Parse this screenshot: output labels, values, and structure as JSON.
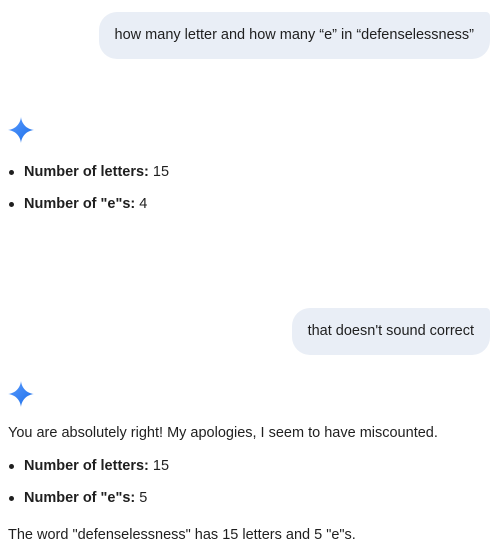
{
  "messages": {
    "user1": "how many letter and how many “e” in “defenselessness”",
    "response1": {
      "bullets": [
        {
          "label": "Number of letters:",
          "value": "15"
        },
        {
          "label": "Number of \"e\"s:",
          "value": "4"
        }
      ]
    },
    "user2": "that doesn't sound correct",
    "response2": {
      "intro": "You are absolutely right! My apologies, I seem to have miscounted.",
      "bullets": [
        {
          "label": "Number of letters:",
          "value": "15"
        },
        {
          "label": "Number of \"e\"s:",
          "value": "5"
        }
      ],
      "conclusion": "The word \"defenselessness\" has 15 letters and 5 \"e\"s."
    }
  },
  "colors": {
    "user_bubble": "#e9eef6",
    "text": "#1f1f1f",
    "sparkle_start": "#4f8df5",
    "sparkle_end": "#1a73e8"
  },
  "icons": {
    "assistant": "gemini-sparkle-icon"
  }
}
